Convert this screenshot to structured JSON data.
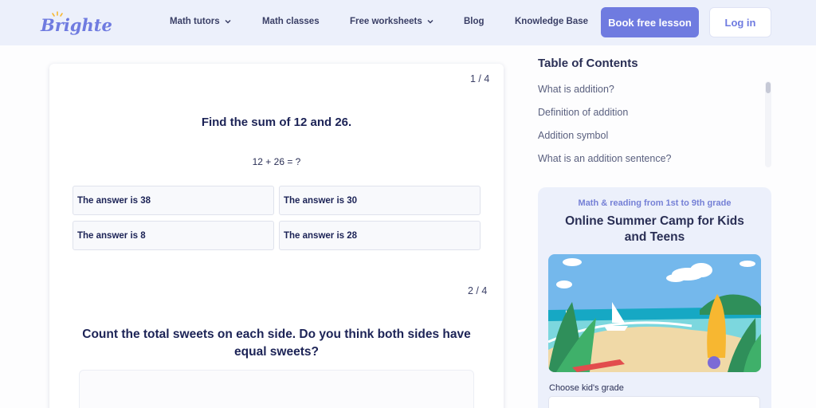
{
  "header": {
    "logo_text": "Brighterly",
    "nav": [
      {
        "label": "Math tutors",
        "has_dropdown": true
      },
      {
        "label": "Math classes",
        "has_dropdown": false
      },
      {
        "label": "Free worksheets",
        "has_dropdown": true
      },
      {
        "label": "Blog",
        "has_dropdown": false
      },
      {
        "label": "Knowledge Base",
        "has_dropdown": false
      }
    ],
    "book_label": "Book free lesson",
    "login_label": "Log in"
  },
  "quiz": {
    "q1": {
      "counter": "1 / 4",
      "title": "Find the sum of 12 and 26.",
      "expression": "12 + 26 = ?",
      "answers": [
        "The answer is 38",
        "The answer is 30",
        "The answer is 8",
        "The answer is 28"
      ]
    },
    "q2": {
      "counter": "2 / 4",
      "title": "Count the total sweets on each side. Do you think both sides have equal sweets?"
    }
  },
  "toc": {
    "title": "Table of Contents",
    "items": [
      "What is addition?",
      "Definition of addition",
      "Addition symbol",
      "What is an addition sentence?"
    ]
  },
  "camp": {
    "subtitle": "Math & reading from 1st to 9th grade",
    "title": "Online Summer Camp for Kids and Teens",
    "grade_label": "Choose kid's grade"
  },
  "colors": {
    "accent": "#6f7be0",
    "header_bg": "#ecf0fb",
    "text_dark": "#1c2356"
  }
}
